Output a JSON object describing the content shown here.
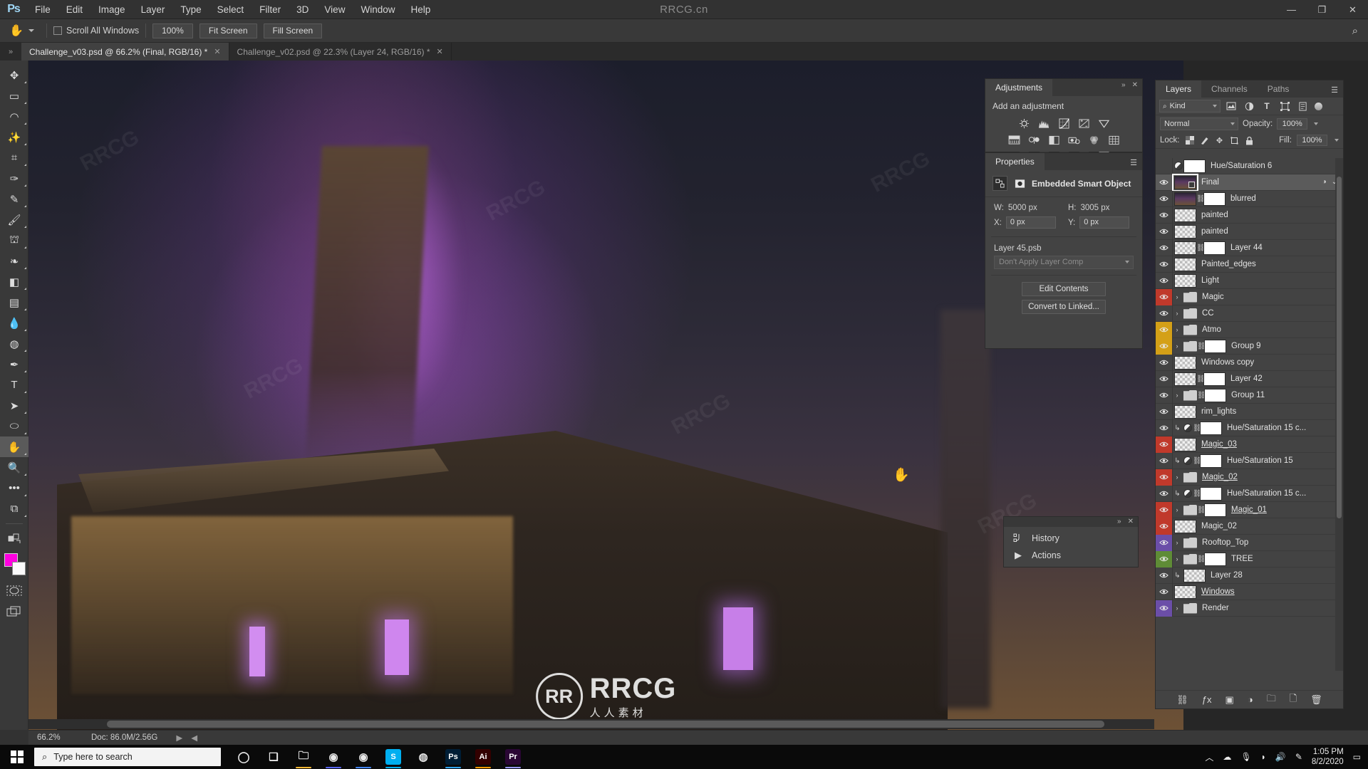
{
  "app": {
    "name": "Adobe Photoshop",
    "logo": "Ps",
    "watermark_top": "RRCG.cn"
  },
  "menubar": {
    "items": [
      "File",
      "Edit",
      "Image",
      "Layer",
      "Type",
      "Select",
      "Filter",
      "3D",
      "View",
      "Window",
      "Help"
    ]
  },
  "window_controls": {
    "minimize": "—",
    "maximize": "❐",
    "close": "✕"
  },
  "options_bar": {
    "tool_icon": "hand-tool-icon",
    "scroll_all_windows_label": "Scroll All Windows",
    "scroll_all_windows_checked": false,
    "buttons": [
      "100%",
      "Fit Screen",
      "Fill Screen"
    ],
    "search_icon": "search-icon"
  },
  "tabs": [
    {
      "label": "Challenge_v03.psd @ 66.2% (Final, RGB/16) *",
      "active": true,
      "close": "✕"
    },
    {
      "label": "Challenge_v02.psd @ 22.3% (Layer 24, RGB/16) *",
      "active": false,
      "close": "✕"
    }
  ],
  "toolbar": {
    "tools": [
      {
        "name": "move-tool",
        "glyph": "✥",
        "selected": false
      },
      {
        "name": "rectangular-marquee-tool",
        "glyph": "▭",
        "selected": false
      },
      {
        "name": "lasso-tool",
        "glyph": "◠",
        "selected": false
      },
      {
        "name": "magic-wand-tool",
        "glyph": "✨",
        "selected": false
      },
      {
        "name": "crop-tool",
        "glyph": "⌗",
        "selected": false
      },
      {
        "name": "eyedropper-tool",
        "glyph": "✑",
        "selected": false
      },
      {
        "name": "spot-healing-brush-tool",
        "glyph": "✎",
        "selected": false
      },
      {
        "name": "brush-tool",
        "glyph": "🖌",
        "selected": false
      },
      {
        "name": "clone-stamp-tool",
        "glyph": "⛫",
        "selected": false
      },
      {
        "name": "history-brush-tool",
        "glyph": "❧",
        "selected": false
      },
      {
        "name": "eraser-tool",
        "glyph": "◧",
        "selected": false
      },
      {
        "name": "gradient-tool",
        "glyph": "▤",
        "selected": false
      },
      {
        "name": "blur-tool",
        "glyph": "💧",
        "selected": false
      },
      {
        "name": "dodge-tool",
        "glyph": "◍",
        "selected": false
      },
      {
        "name": "pen-tool",
        "glyph": "✒",
        "selected": false
      },
      {
        "name": "type-tool",
        "glyph": "T",
        "selected": false
      },
      {
        "name": "path-selection-tool",
        "glyph": "➤",
        "selected": false
      },
      {
        "name": "ellipse-tool",
        "glyph": "⬭",
        "selected": false
      },
      {
        "name": "hand-tool",
        "glyph": "✋",
        "selected": true
      },
      {
        "name": "zoom-tool",
        "glyph": "🔍",
        "selected": false
      },
      {
        "name": "edit-toolbar-tool",
        "glyph": "•••",
        "selected": false
      },
      {
        "name": "default-colors-tool",
        "glyph": "⧉",
        "selected": false
      }
    ],
    "foreground_color": "#ff00e0",
    "background_color": "#fbfbfb",
    "quick_mask_icon": "quick-mask-icon",
    "screen_mode_icon": "screen-mode-icon"
  },
  "canvas": {
    "cursor_icon": "hand-cursor-icon",
    "watermark_initials": "RR",
    "watermark_main": "RRCG",
    "watermark_sub": "人人素材",
    "diagonal_watermarks": [
      "RRCG",
      "RRCG",
      "RRCG",
      "RRCG",
      "RRCG",
      "RRCG"
    ]
  },
  "status_bar": {
    "zoom": "66.2%",
    "doc": "Doc: 86.0M/2.56G",
    "next_icon": "▶",
    "prev_icon": "◀"
  },
  "adjustments_panel": {
    "tab": "Adjustments",
    "title": "Add an adjustment",
    "menu_icon": "panel-menu-icon",
    "collapse_icon": "collapse-icon",
    "close_icon": "close-icon",
    "icons": [
      [
        "brightness-contrast-icon",
        "levels-icon",
        "curves-icon",
        "exposure-icon",
        "vibrance-icon"
      ],
      [
        "hue-saturation-icon",
        "color-balance-icon",
        "black-white-icon",
        "photo-filter-icon",
        "channel-mixer-icon",
        "color-lookup-icon"
      ],
      [
        "invert-icon",
        "posterize-icon",
        "threshold-icon",
        "selective-color-icon",
        "gradient-map-icon"
      ]
    ]
  },
  "properties_panel": {
    "tab": "Properties",
    "menu_icon": "panel-menu-icon",
    "header_icon_1": "smart-object-icon",
    "header_icon_2": "mask-icon",
    "header_title": "Embedded Smart Object",
    "w_label": "W:",
    "w_value": "5000 px",
    "h_label": "H:",
    "h_value": "3005 px",
    "x_label": "X:",
    "x_value": "0 px",
    "y_label": "Y:",
    "y_value": "0 px",
    "filename": "Layer 45.psb",
    "layer_comp_placeholder": "Don't Apply Layer Comp",
    "edit_contents_label": "Edit Contents",
    "convert_to_linked_label": "Convert to Linked..."
  },
  "history_panel": {
    "collapse_icon": "collapse-icon",
    "close_icon": "close-icon",
    "items": [
      {
        "label": "History",
        "icon": "history-icon"
      },
      {
        "label": "Actions",
        "icon": "actions-play-icon"
      }
    ]
  },
  "layers_panel": {
    "tabs": [
      {
        "label": "Layers",
        "active": true
      },
      {
        "label": "Channels",
        "active": false
      },
      {
        "label": "Paths",
        "active": false
      }
    ],
    "menu_icon": "panel-menu-icon",
    "filter": {
      "kind_label": "Kind",
      "search_icon": "search-icon",
      "type_icons": [
        "pixel-filter-icon",
        "adjustment-filter-icon",
        "type-filter-icon",
        "shape-filter-icon",
        "smart-object-filter-icon"
      ],
      "toggle_icon": "filter-toggle-icon"
    },
    "blend_mode": "Normal",
    "opacity_label": "Opacity:",
    "opacity_value": "100%",
    "lock_label": "Lock:",
    "lock_icons": [
      "lock-transparent-pixels-icon",
      "lock-image-pixels-icon",
      "lock-position-icon",
      "lock-artboard-icon",
      "lock-all-icon"
    ],
    "fill_label": "Fill:",
    "fill_value": "100%",
    "layers": [
      {
        "name": "Hue/Saturation 6",
        "visible": false,
        "type": "adjustment",
        "mask": true,
        "color": ""
      },
      {
        "name": "Final",
        "visible": true,
        "type": "smart-object",
        "thumb": "art",
        "selected": true,
        "color": "",
        "right_icons": [
          "fx-circle-icon",
          "chevron-down-icon"
        ]
      },
      {
        "name": "blurred",
        "visible": true,
        "type": "pixel",
        "thumb": "art",
        "mask": true,
        "link": true,
        "color": ""
      },
      {
        "name": "painted",
        "visible": true,
        "type": "pixel",
        "thumb": "checker",
        "color": ""
      },
      {
        "name": "painted",
        "visible": true,
        "type": "pixel",
        "thumb": "checker",
        "color": ""
      },
      {
        "name": "Layer 44",
        "visible": true,
        "type": "pixel",
        "thumb": "checker",
        "mask": true,
        "link": true,
        "color": ""
      },
      {
        "name": "Painted_edges",
        "visible": true,
        "type": "pixel",
        "thumb": "checker",
        "color": ""
      },
      {
        "name": "Light",
        "visible": true,
        "type": "pixel",
        "thumb": "checker",
        "color": ""
      },
      {
        "name": "Magic",
        "visible": true,
        "type": "group",
        "color": "#c0392b"
      },
      {
        "name": "CC",
        "visible": true,
        "type": "group",
        "color": ""
      },
      {
        "name": "Atmo",
        "visible": true,
        "type": "group",
        "color": "#d4a017"
      },
      {
        "name": "Group 9",
        "visible": true,
        "type": "group",
        "mask": true,
        "link": true,
        "color": "#d4a017"
      },
      {
        "name": "Windows copy",
        "visible": true,
        "type": "pixel",
        "thumb": "checker",
        "color": ""
      },
      {
        "name": "Layer 42",
        "visible": true,
        "type": "pixel",
        "thumb": "checker",
        "mask": true,
        "link": true,
        "color": ""
      },
      {
        "name": "Group 11",
        "visible": true,
        "type": "group",
        "mask": true,
        "link": true,
        "color": ""
      },
      {
        "name": "rim_lights",
        "visible": true,
        "type": "pixel",
        "thumb": "checker",
        "color": ""
      },
      {
        "name": "Hue/Saturation 15 c...",
        "visible": true,
        "type": "adjustment",
        "clipped": true,
        "mask": true,
        "link": true,
        "color": ""
      },
      {
        "name": "Magic_03",
        "visible": true,
        "type": "pixel",
        "thumb": "checker",
        "underline": true,
        "color": "#c0392b"
      },
      {
        "name": "Hue/Saturation 15",
        "visible": true,
        "type": "adjustment",
        "clipped": true,
        "mask": true,
        "link": true,
        "color": ""
      },
      {
        "name": "Magic_02",
        "visible": true,
        "type": "group",
        "underline": true,
        "color": "#c0392b"
      },
      {
        "name": "Hue/Saturation 15 c...",
        "visible": true,
        "type": "adjustment",
        "clipped": true,
        "mask": true,
        "link": true,
        "color": ""
      },
      {
        "name": "Magic_01",
        "visible": true,
        "type": "group",
        "mask": true,
        "link": true,
        "underline": true,
        "color": "#c0392b"
      },
      {
        "name": "Magic_02",
        "visible": true,
        "type": "pixel",
        "thumb": "checker",
        "color": "#c0392b"
      },
      {
        "name": "Rooftop_Top",
        "visible": true,
        "type": "group",
        "color": "#6b4ea8"
      },
      {
        "name": "TREE",
        "visible": true,
        "type": "group",
        "mask": true,
        "link": true,
        "color": "#5f8c36"
      },
      {
        "name": "Layer 28",
        "visible": true,
        "type": "pixel",
        "thumb": "checker",
        "clipped": true,
        "color": ""
      },
      {
        "name": "Windows",
        "visible": true,
        "type": "pixel",
        "thumb": "checker",
        "underline": true,
        "color": ""
      },
      {
        "name": "Render",
        "visible": true,
        "type": "group",
        "color": "#6b4ea8"
      }
    ],
    "bottom_buttons": [
      "link-layers-icon",
      "layer-style-fx-icon",
      "add-layer-mask-icon",
      "new-adjustment-layer-icon",
      "new-group-icon",
      "new-layer-icon",
      "delete-layer-icon"
    ]
  },
  "taskbar": {
    "start_icon": "windows-start-icon",
    "search_placeholder": "Type here to search",
    "search_icon": "search-icon",
    "apps": [
      {
        "name": "cortana-icon",
        "glyph": "◯",
        "color": "#0a0a0a",
        "text": "",
        "indicator": ""
      },
      {
        "name": "task-view-icon",
        "glyph": "❑",
        "color": "#0a0a0a",
        "text": "",
        "indicator": ""
      },
      {
        "name": "file-explorer-icon",
        "glyph": "🗀",
        "color": "#f7b733",
        "text": "",
        "indicator": "#f7b733"
      },
      {
        "name": "discord-icon",
        "glyph": "◉",
        "color": "#5865f2",
        "text": "",
        "indicator": "#5865f2"
      },
      {
        "name": "chrome-icon",
        "glyph": "◉",
        "color": "#4285f4",
        "text": "",
        "indicator": "#4285f4"
      },
      {
        "name": "skype-icon",
        "glyph": "S",
        "color": "#00aff0",
        "text": "S",
        "indicator": "#00aff0"
      },
      {
        "name": "browser-icon",
        "glyph": "◍",
        "color": "#6f8fa8",
        "text": "",
        "indicator": ""
      },
      {
        "name": "photoshop-icon",
        "glyph": "Ps",
        "color": "#001e36",
        "text": "Ps",
        "indicator": "#31a8ff"
      },
      {
        "name": "illustrator-icon",
        "glyph": "Ai",
        "color": "#330000",
        "text": "Ai",
        "indicator": "#ff9a00"
      },
      {
        "name": "premiere-icon",
        "glyph": "Pr",
        "color": "#2a0634",
        "text": "Pr",
        "indicator": "#9999ff"
      }
    ],
    "tray": {
      "chevron_icon": "show-hidden-icons-icon",
      "cloud_icon": "onedrive-icon",
      "mic_icon": "microphone-icon",
      "wifi_icon": "wifi-icon",
      "volume_icon": "volume-icon",
      "pen_icon": "pen-icon",
      "time": "1:05 PM",
      "date": "8/2/2020",
      "notification_icon": "action-center-icon"
    }
  }
}
